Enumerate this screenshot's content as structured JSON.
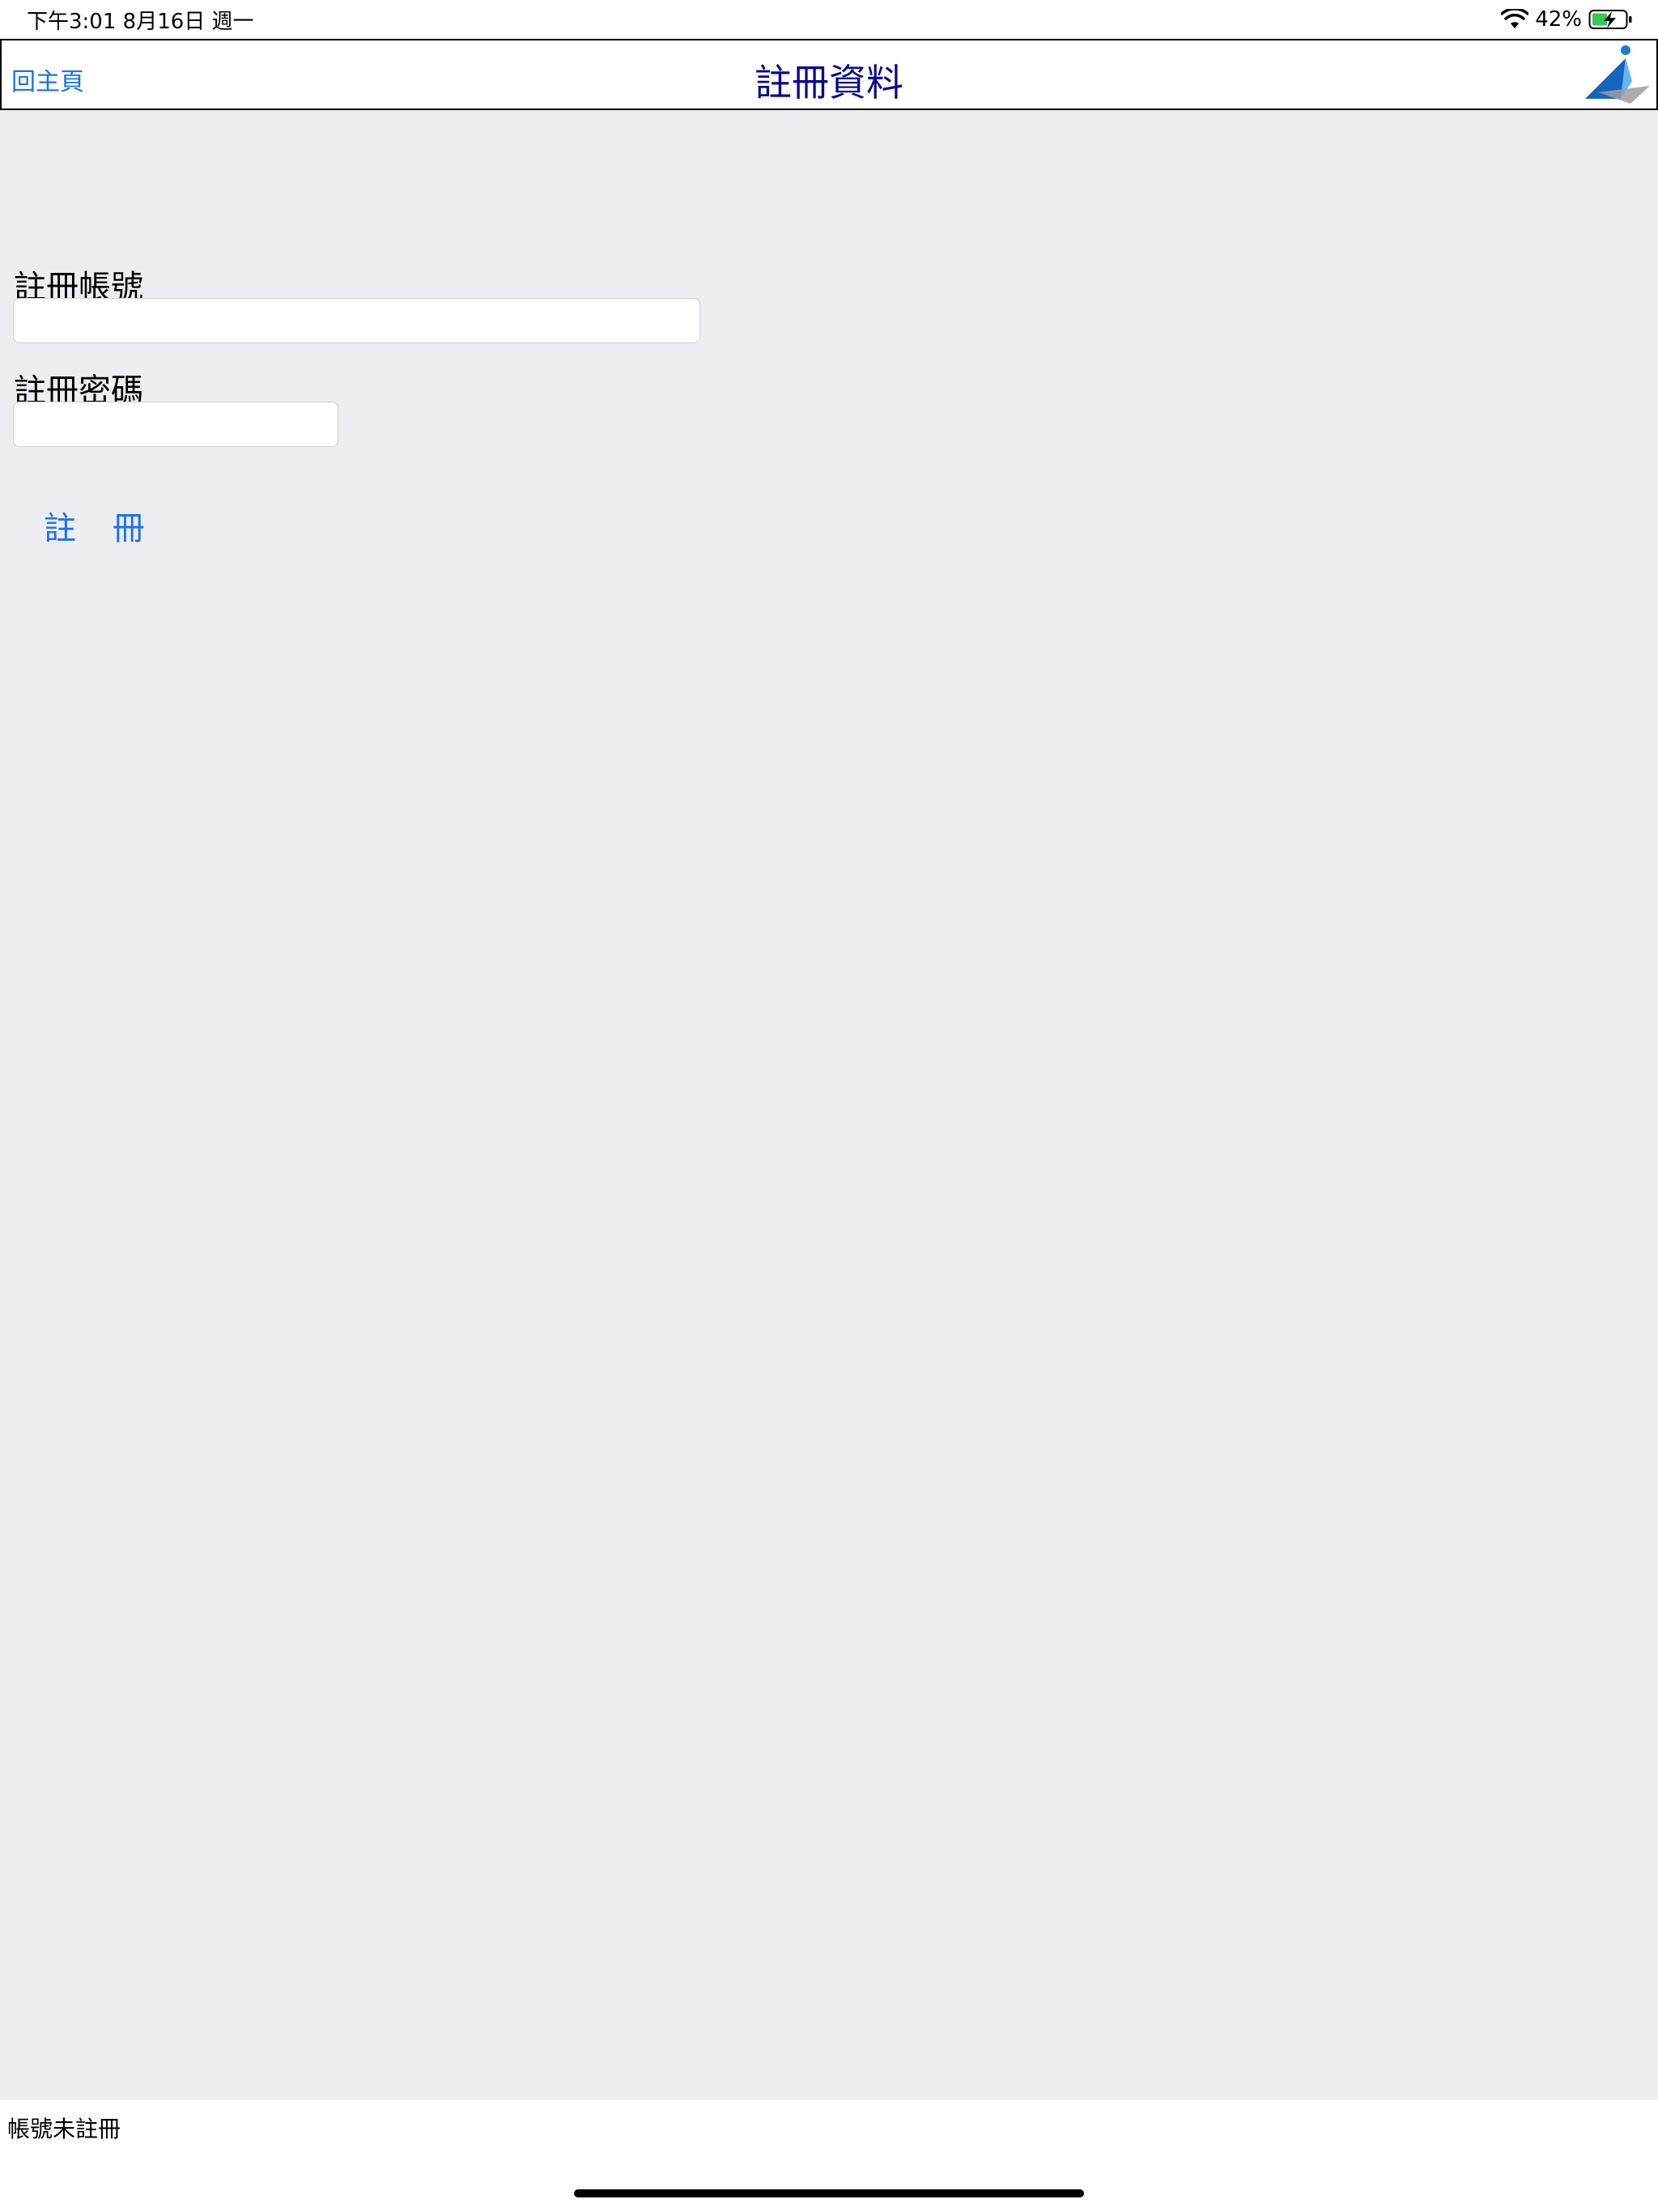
{
  "status_bar": {
    "time_date": "下午3:01   8月16日 週一",
    "battery_percent": "42%"
  },
  "nav": {
    "back_label": "回主頁",
    "title": "註冊資料"
  },
  "form": {
    "account_label": "註冊帳號",
    "account_value": "",
    "password_label": "註冊密碼",
    "password_value": "",
    "register_label": "註 冊"
  },
  "footer": {
    "status_text": "帳號未註冊"
  },
  "colors": {
    "background": "#ededf2",
    "link": "#1a73e8",
    "title": "#0a0a8c",
    "battery_charge": "#34c759"
  },
  "icons": [
    "wifi-icon",
    "battery-charging-icon",
    "app-logo-icon"
  ]
}
